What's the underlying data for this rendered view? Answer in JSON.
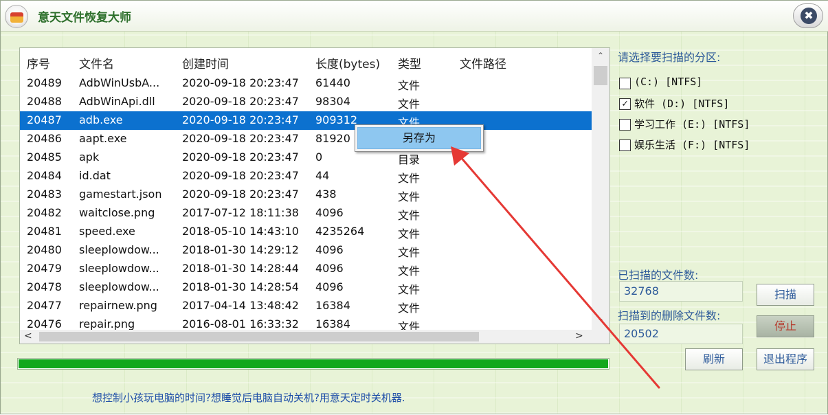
{
  "window": {
    "title": "意天文件恢复大师",
    "close_glyph": "✖"
  },
  "list": {
    "columns": [
      "序号",
      "文件名",
      "创建时间",
      "长度(bytes)",
      "类型",
      "文件路径"
    ],
    "rows": [
      {
        "id": "20489",
        "name": "AdbWinUsbA...",
        "created": "2020-09-18 20:23:47",
        "size": "61440",
        "type": "文件",
        "path": ""
      },
      {
        "id": "20488",
        "name": "AdbWinApi.dll",
        "created": "2020-09-18 20:23:47",
        "size": "98304",
        "type": "文件",
        "path": ""
      },
      {
        "id": "20487",
        "name": "adb.exe",
        "created": "2020-09-18 20:23:47",
        "size": "909312",
        "type": "文件",
        "path": ""
      },
      {
        "id": "20486",
        "name": "aapt.exe",
        "created": "2020-09-18 20:23:47",
        "size": "81920",
        "type": "文件",
        "path": ""
      },
      {
        "id": "20485",
        "name": "apk",
        "created": "2020-09-18 20:23:47",
        "size": "0",
        "type": "目录",
        "path": ""
      },
      {
        "id": "20484",
        "name": "id.dat",
        "created": "2020-09-18 20:23:47",
        "size": "44",
        "type": "文件",
        "path": ""
      },
      {
        "id": "20483",
        "name": "gamestart.json",
        "created": "2020-09-18 20:23:47",
        "size": "438",
        "type": "文件",
        "path": ""
      },
      {
        "id": "20482",
        "name": "waitclose.png",
        "created": "2017-07-12 18:11:38",
        "size": "4096",
        "type": "文件",
        "path": ""
      },
      {
        "id": "20481",
        "name": "speed.exe",
        "created": "2018-05-10 14:43:10",
        "size": "4235264",
        "type": "文件",
        "path": ""
      },
      {
        "id": "20480",
        "name": "sleeplowdow...",
        "created": "2018-01-30 14:29:12",
        "size": "4096",
        "type": "文件",
        "path": ""
      },
      {
        "id": "20479",
        "name": "sleeplowdow...",
        "created": "2018-01-30 14:28:44",
        "size": "4096",
        "type": "文件",
        "path": ""
      },
      {
        "id": "20478",
        "name": "sleeplowdow...",
        "created": "2018-01-30 14:28:54",
        "size": "4096",
        "type": "文件",
        "path": ""
      },
      {
        "id": "20477",
        "name": "repairnew.png",
        "created": "2017-04-14 13:48:42",
        "size": "16384",
        "type": "文件",
        "path": ""
      },
      {
        "id": "20476",
        "name": "repair.png",
        "created": "2016-08-01 16:33:32",
        "size": "16384",
        "type": "文件",
        "path": ""
      }
    ],
    "selected_index": 2,
    "scroll_up": "⌃",
    "scroll_down": "⌄",
    "scroll_left": "<",
    "scroll_right": ">"
  },
  "context_menu": {
    "items": [
      "另存为"
    ]
  },
  "sidebar": {
    "partition_prompt": "请选择要扫描的分区:",
    "partitions": [
      {
        "label": "(C:) [NTFS]",
        "checked": false
      },
      {
        "label": "软件 (D:) [NTFS]",
        "checked": true
      },
      {
        "label": "学习工作 (E:) [NTFS]",
        "checked": false
      },
      {
        "label": "娱乐生活 (F:) [NTFS]",
        "checked": false
      }
    ],
    "scanned_label": "已扫描的文件数:",
    "scanned_value": "32768",
    "deleted_label": "扫描到的删除文件数:",
    "deleted_value": "20502",
    "scan_button": "扫描",
    "stop_button": "停止",
    "refresh_button": "刷新",
    "exit_button": "退出程序"
  },
  "progress": {
    "percent": 100
  },
  "footer": {
    "promo_text": "想控制小孩玩电脑的时间?想睡觉后电脑自动关机?用意天定时关机器."
  },
  "colors": {
    "selection": "#0c71cf",
    "progress": "#12a81c",
    "arrow": "#e53935",
    "accent_text": "#2d5a9a"
  }
}
